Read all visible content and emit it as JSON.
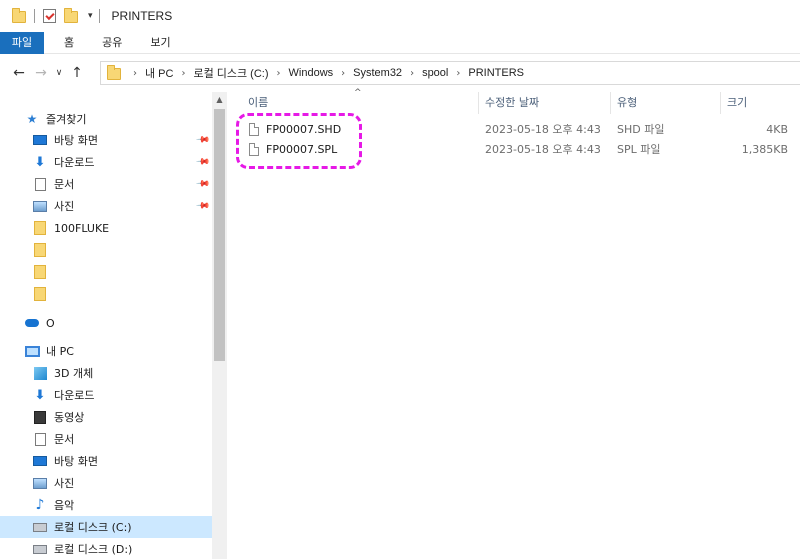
{
  "titlebar": {
    "title": "PRINTERS"
  },
  "ribbon": {
    "tabs": [
      "파일",
      "홈",
      "공유",
      "보기"
    ]
  },
  "address": {
    "crumbs": [
      "내 PC",
      "로컬 디스크 (C:)",
      "Windows",
      "System32",
      "spool",
      "PRINTERS"
    ]
  },
  "nav": {
    "quick_access": "즐겨찾기",
    "items": [
      {
        "label": "바탕 화면",
        "icon": "desktop-icon",
        "pinned": true
      },
      {
        "label": "다운로드",
        "icon": "download-icon",
        "pinned": true
      },
      {
        "label": "문서",
        "icon": "document-icon",
        "pinned": true
      },
      {
        "label": "사진",
        "icon": "pictures-icon",
        "pinned": true
      },
      {
        "label": "100FLUKE",
        "icon": "folder-icon",
        "pinned": false
      },
      {
        "label": "",
        "icon": "folder-icon",
        "pinned": false
      },
      {
        "label": "",
        "icon": "folder-icon",
        "pinned": false
      },
      {
        "label": "",
        "icon": "folder-icon",
        "pinned": false
      }
    ],
    "onedrive": "O",
    "thispc": "내 PC",
    "pc_items": [
      {
        "label": "3D 개체",
        "icon": "3d-objects-icon"
      },
      {
        "label": "다운로드",
        "icon": "download-icon"
      },
      {
        "label": "동영상",
        "icon": "video-icon"
      },
      {
        "label": "문서",
        "icon": "document-icon"
      },
      {
        "label": "바탕 화면",
        "icon": "desktop-icon"
      },
      {
        "label": "사진",
        "icon": "pictures-icon"
      },
      {
        "label": "음악",
        "icon": "music-icon"
      },
      {
        "label": "로컬 디스크 (C:)",
        "icon": "drive-icon",
        "selected": true
      },
      {
        "label": "로컬 디스크 (D:)",
        "icon": "drive-icon"
      }
    ]
  },
  "columns": {
    "name": "이름",
    "modified": "수정한 날짜",
    "type": "유형",
    "size": "크기"
  },
  "files": [
    {
      "name": "FP00007.SHD",
      "modified": "2023-05-18 오후 4:43",
      "type": "SHD 파일",
      "size": "4KB"
    },
    {
      "name": "FP00007.SPL",
      "modified": "2023-05-18 오후 4:43",
      "type": "SPL 파일",
      "size": "1,385KB"
    }
  ],
  "colors": {
    "accent": "#1a6fbd",
    "highlight": "#e619e6",
    "selected": "#cce8ff"
  }
}
